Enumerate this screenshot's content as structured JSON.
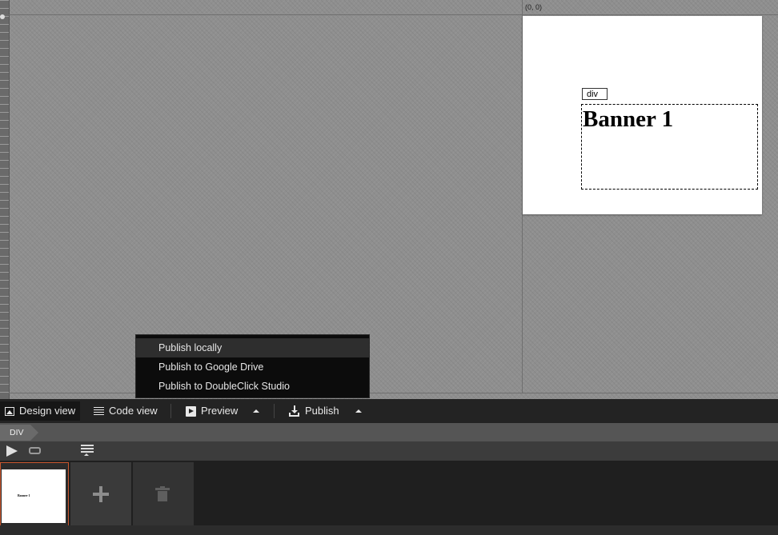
{
  "canvas": {
    "origin_label": "(0, 0)",
    "element_tag": "div",
    "banner_text": "Banner 1"
  },
  "publish_menu": {
    "items": [
      {
        "label": "Publish locally",
        "active": true
      },
      {
        "label": "Publish to Google Drive",
        "active": false
      },
      {
        "label": "Publish to DoubleClick Studio",
        "active": false
      }
    ]
  },
  "toolbar": {
    "design_view": "Design view",
    "code_view": "Code view",
    "preview": "Preview",
    "publish": "Publish"
  },
  "breadcrumb": {
    "item": "DIV"
  },
  "pages": {
    "thumb_text": "Banner 1",
    "selected_border_color": "#c9562e"
  },
  "icons": {
    "design": "image-icon",
    "code": "lines-icon",
    "preview": "play-box-icon",
    "publish": "download-tray-icon",
    "timeline_play": "play-icon",
    "timeline_loop": "loop-icon",
    "events": "events-icon",
    "add_page": "plus-icon",
    "delete_page": "trash-icon"
  }
}
